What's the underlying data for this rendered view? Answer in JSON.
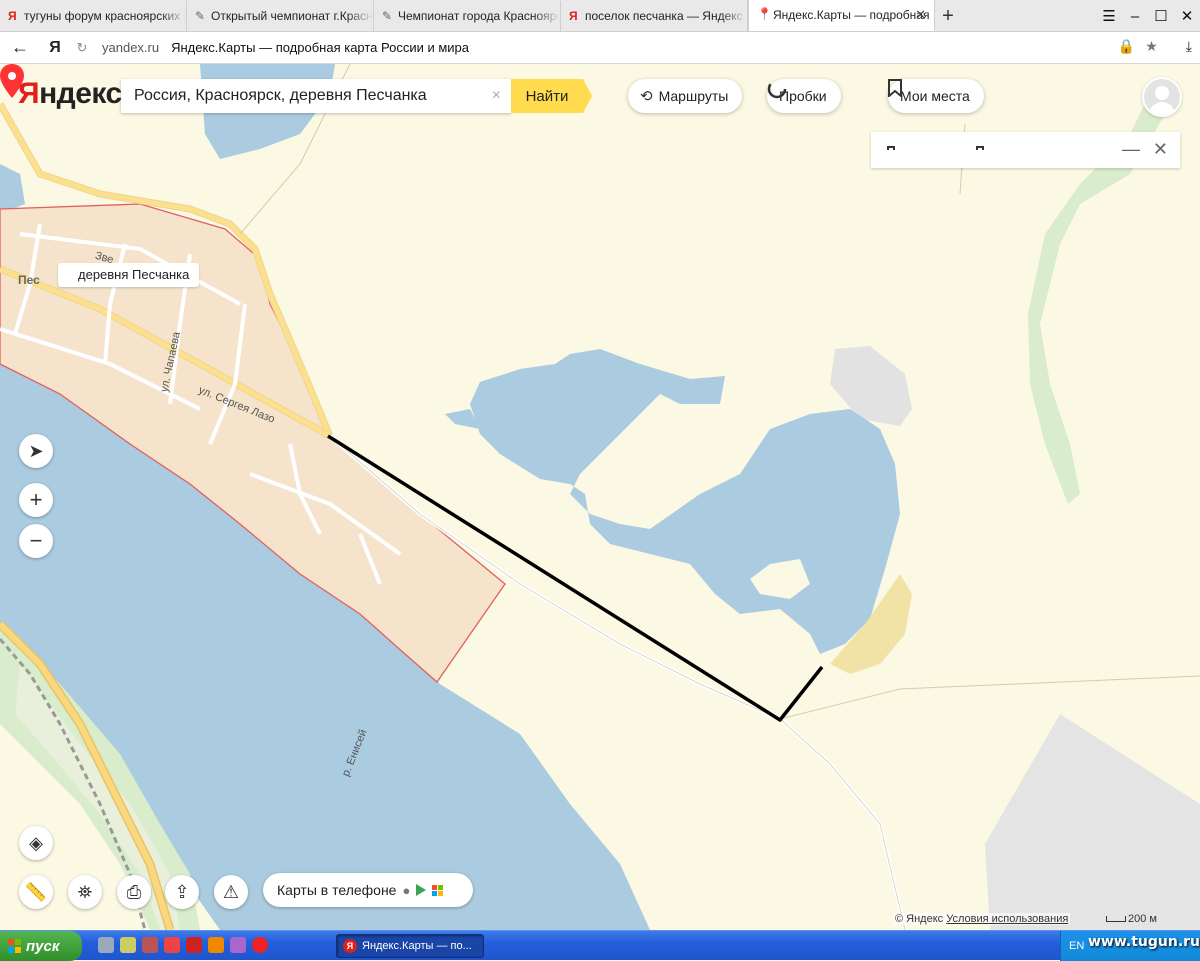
{
  "browser": {
    "tabs": [
      {
        "label": "тугуны форум красноярских рыбаков",
        "icon": "yandex-icon",
        "active": false
      },
      {
        "label": "Открытый чемпионат г.Красноярска",
        "icon": "pen-icon",
        "active": false
      },
      {
        "label": "Чемпионат города Красноярска",
        "icon": "pen-icon",
        "active": false
      },
      {
        "label": "поселок песчанка — Яндекс",
        "icon": "yandex-icon",
        "active": false
      },
      {
        "label": "Яндекс.Карты — подробная",
        "icon": "map-pin-icon",
        "active": true
      }
    ],
    "address_domain": "yandex.ru",
    "page_title": "Яндекс.Карты — подробная карта России и мира",
    "logo_letter": "Я"
  },
  "map_ui": {
    "logo": {
      "first": "Я",
      "rest": "ндекс"
    },
    "search": {
      "value": "Россия, Красноярск, деревня Песчанка",
      "clear": "×"
    },
    "find_label": "Найти",
    "routes_label": "Маршруты",
    "traffic_label": "Пробки",
    "places_label": "Мои места",
    "phone_label": "Карты в телефоне",
    "copyright": "© Яндекс",
    "terms": "Условия использования",
    "scale": "200 м"
  },
  "map_content": {
    "poi": "деревня Песчанка",
    "streets": {
      "lazo": "ул. Сергея Лазо",
      "chapaeva": "ул. Чапаева",
      "river": "р. Енисей",
      "village_partial": "Пес",
      "zver_partial": "Зве"
    }
  },
  "taskbar": {
    "start": "пуск",
    "item": "Яндекс.Карты — по...",
    "lang": "EN",
    "watermark": "www.tugun.ru"
  },
  "colors": {
    "land": "#fbf8e3",
    "water": "#aacbe0",
    "settlement": "#f5e4cb",
    "road_main": "#fbe08f",
    "accent": "#ffdb4d",
    "brand_red": "#e0201a"
  }
}
